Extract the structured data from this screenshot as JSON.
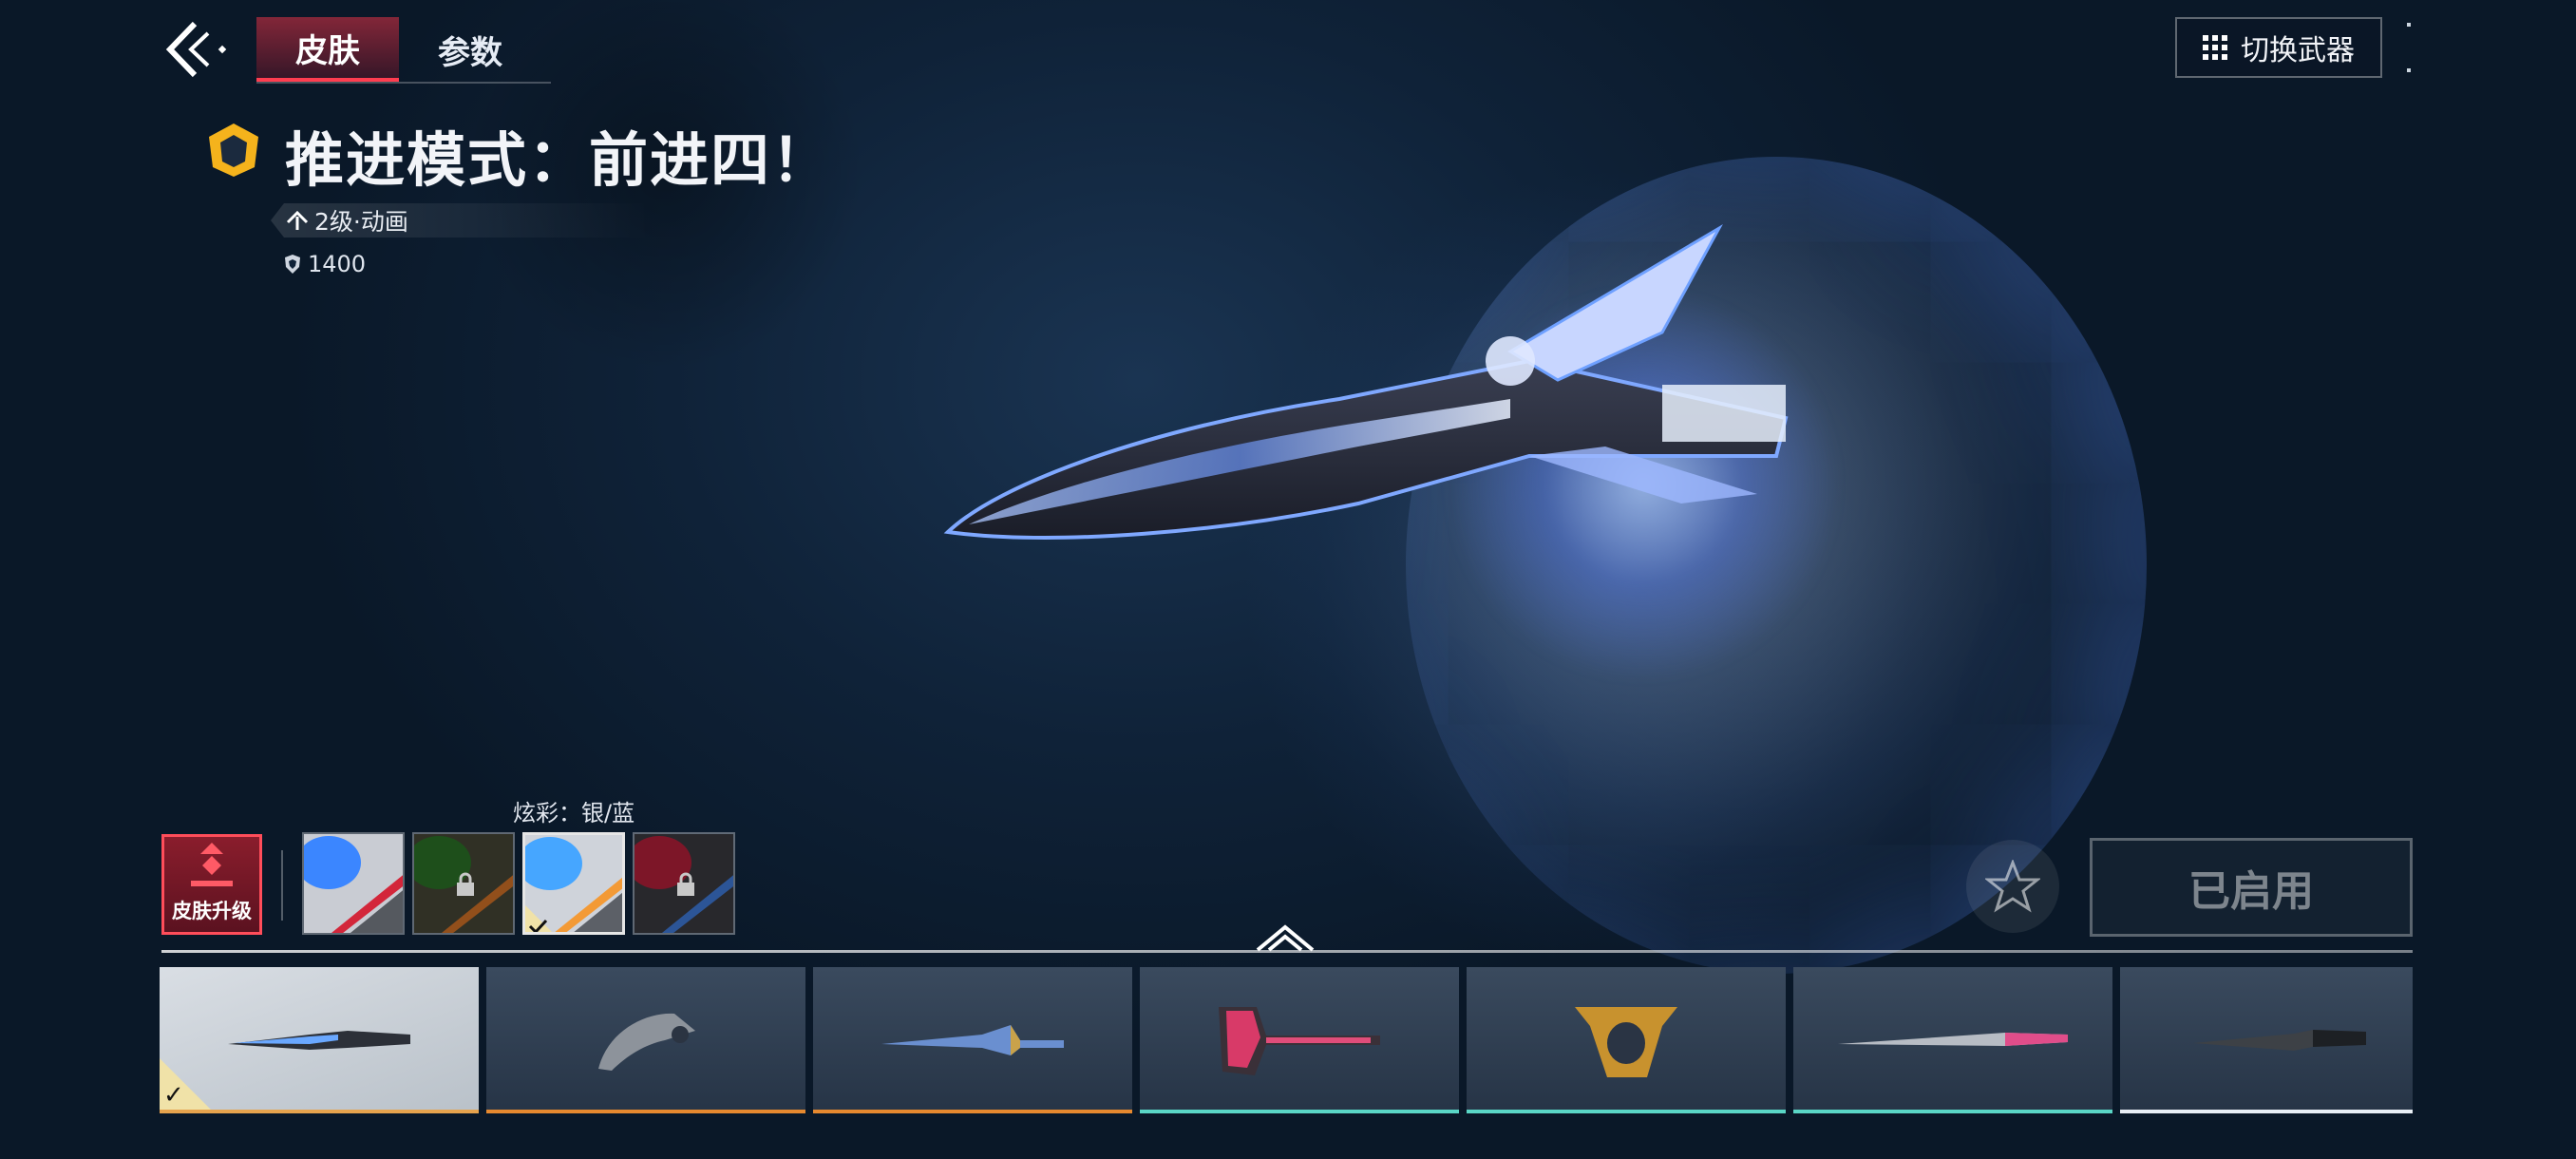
{
  "nav": {
    "tabs": [
      {
        "label": "皮肤",
        "active": true
      },
      {
        "label": "参数",
        "active": false
      }
    ],
    "switch_weapon_label": "切换武器"
  },
  "skin": {
    "title": "推进模式：前进四！",
    "level_tag": "2级·动画",
    "price": "1400",
    "rank_color": "#f5b31c"
  },
  "variants": {
    "label": "炫彩：银/蓝",
    "upgrade_label": "皮肤升级",
    "swatches": [
      {
        "name": "blue-red",
        "locked": false,
        "selected": false,
        "orb": "#3b86ff",
        "stripe": "#d3263a"
      },
      {
        "name": "green-orange",
        "locked": true,
        "selected": false,
        "orb": "#2f7a2a",
        "stripe": "#e07a2a"
      },
      {
        "name": "silver-blue",
        "locked": false,
        "selected": true,
        "orb": "#46a6ff",
        "stripe": "#f39a36"
      },
      {
        "name": "red-blue",
        "locked": true,
        "selected": false,
        "orb": "#b3203a",
        "stripe": "#3f7ad8"
      }
    ]
  },
  "actions": {
    "equipped_label": "已启用"
  },
  "weapon_cards": [
    {
      "name": "knife-1",
      "selected": true,
      "bar_color": "#e6a34d"
    },
    {
      "name": "karambit",
      "selected": false,
      "bar_color": "#e6892f"
    },
    {
      "name": "dagger-blue",
      "selected": false,
      "bar_color": "#e6892f"
    },
    {
      "name": "axe-pink",
      "selected": false,
      "bar_color": "#5ad6c6"
    },
    {
      "name": "knuckle-gold",
      "selected": false,
      "bar_color": "#5ad6c6"
    },
    {
      "name": "sword-long",
      "selected": false,
      "bar_color": "#5ad6c6"
    },
    {
      "name": "combat-knife",
      "selected": false,
      "bar_color": "#e8eef5"
    }
  ]
}
